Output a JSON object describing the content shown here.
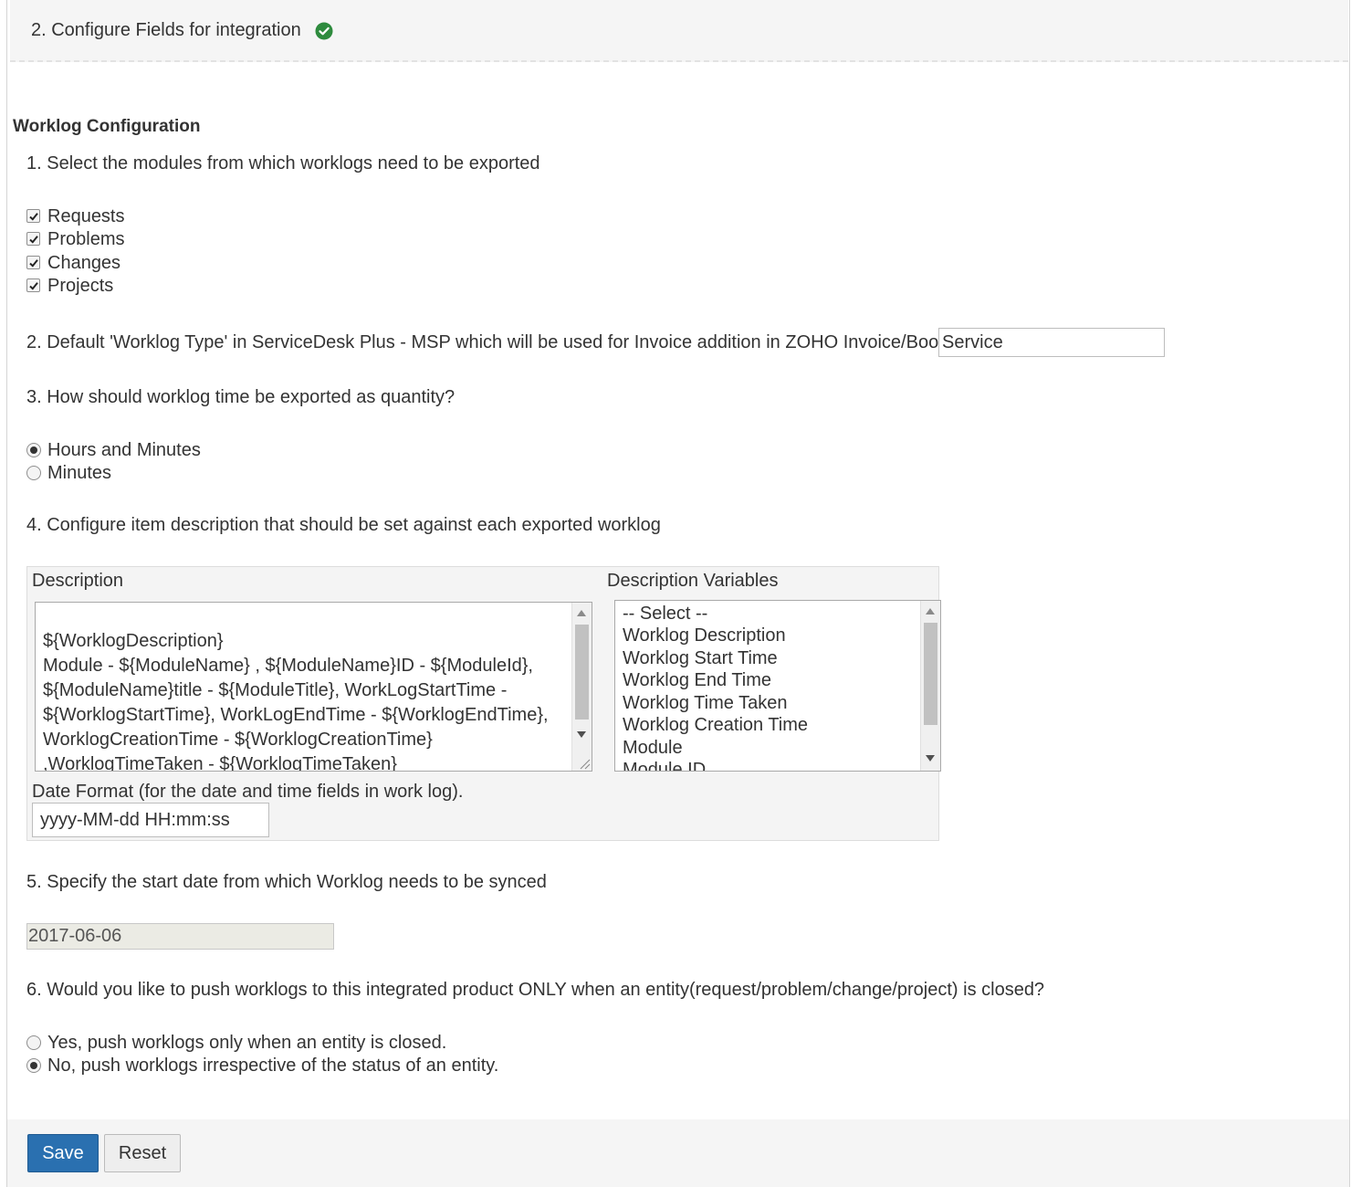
{
  "step": {
    "title": "2. Configure Fields for integration",
    "status_icon": "check-circle-icon",
    "status_color": "#2e8b3e"
  },
  "section_title": "Worklog Configuration",
  "q1": {
    "text": "1. Select the modules from which worklogs need to be exported",
    "options": [
      {
        "label": "Requests",
        "checked": true
      },
      {
        "label": "Problems",
        "checked": true
      },
      {
        "label": "Changes",
        "checked": true
      },
      {
        "label": "Projects",
        "checked": true
      }
    ]
  },
  "q2": {
    "text": "2. Default 'Worklog Type' in ServiceDesk Plus - MSP which will be used for Invoice addition in ZOHO Invoice/Books",
    "value": "Service"
  },
  "q3": {
    "text": "3. How should worklog time be exported as quantity?",
    "options": [
      {
        "label": "Hours and Minutes",
        "selected": true
      },
      {
        "label": "Minutes",
        "selected": false
      }
    ]
  },
  "q4": {
    "text": "4. Configure item description that should be set against each exported worklog",
    "description_label": "Description",
    "description_value": "${WorklogDescription}\nModule - ${ModuleName} , ${ModuleName}ID - ${ModuleId}, ${ModuleName}title - ${ModuleTitle}, WorkLogStartTime - ${WorklogStartTime}, WorkLogEndTime - ${WorklogEndTime}, WorklogCreationTime - ${WorklogCreationTime} ,WorklogTimeTaken - ${WorklogTimeTaken}",
    "variables_label": "Description Variables",
    "variables": [
      "-- Select --",
      "Worklog Description",
      "Worklog Start Time",
      "Worklog End Time",
      "Worklog Time Taken",
      "Worklog Creation Time",
      "Module",
      "Module ID"
    ],
    "date_format_label": "Date Format (for the date and time fields in work log).",
    "date_format_value": "yyyy-MM-dd HH:mm:ss"
  },
  "q5": {
    "text": "5. Specify the start date from which Worklog needs to be synced",
    "value": "2017-06-06"
  },
  "q6": {
    "text": "6. Would you like to push worklogs to this integrated product ONLY when an entity(request/problem/change/project) is closed?",
    "options": [
      {
        "label": "Yes, push worklogs only when an entity is closed.",
        "selected": false
      },
      {
        "label": "No, push worklogs irrespective of the status of an entity.",
        "selected": true
      }
    ]
  },
  "buttons": {
    "save": "Save",
    "reset": "Reset"
  },
  "colors": {
    "primary_button": "#2a70b0"
  }
}
